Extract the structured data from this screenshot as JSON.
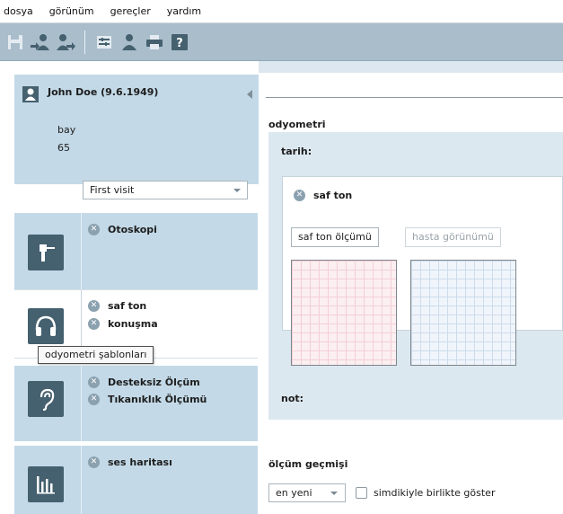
{
  "menu": [
    "dosya",
    "görünüm",
    "gereçler",
    "yardım"
  ],
  "toolbar": {
    "icons": [
      "save-icon",
      "patient-in-icon",
      "patient-out-icon",
      "settings-icon",
      "user-icon",
      "print-icon",
      "help-icon"
    ],
    "help_glyph": "?"
  },
  "patient": {
    "name": "John Doe (9.6.1949)",
    "gender": "bay",
    "age": "65"
  },
  "visit": {
    "selected": "First visit"
  },
  "modules": {
    "otoskopi": {
      "items": [
        "Otoskopi"
      ]
    },
    "odyometri": {
      "items": [
        "saf ton",
        "konuşma"
      ],
      "tooltip": "odyometri şablonları"
    },
    "olcum": {
      "items": [
        "Desteksiz Ölçüm",
        "Tıkanıklık Ölçümü"
      ]
    },
    "ses": {
      "items": [
        "ses haritası"
      ]
    }
  },
  "content": {
    "section_title": "odyometri",
    "tarih_label": "tarih:",
    "test_title": "saf ton",
    "tabs": [
      "saf ton ölçümü",
      "hasta görünümü"
    ],
    "note_label": "not:",
    "history_title": "ölçüm geçmişi",
    "history_select": "en yeni",
    "history_checkbox_label": "simdikiyle birlikte göster"
  },
  "colors": {
    "toolbar": "#a9bdcb",
    "sidebar_panel": "#c3d9e7",
    "icon_dark": "#45606f",
    "content_bg": "#dce7ef"
  }
}
